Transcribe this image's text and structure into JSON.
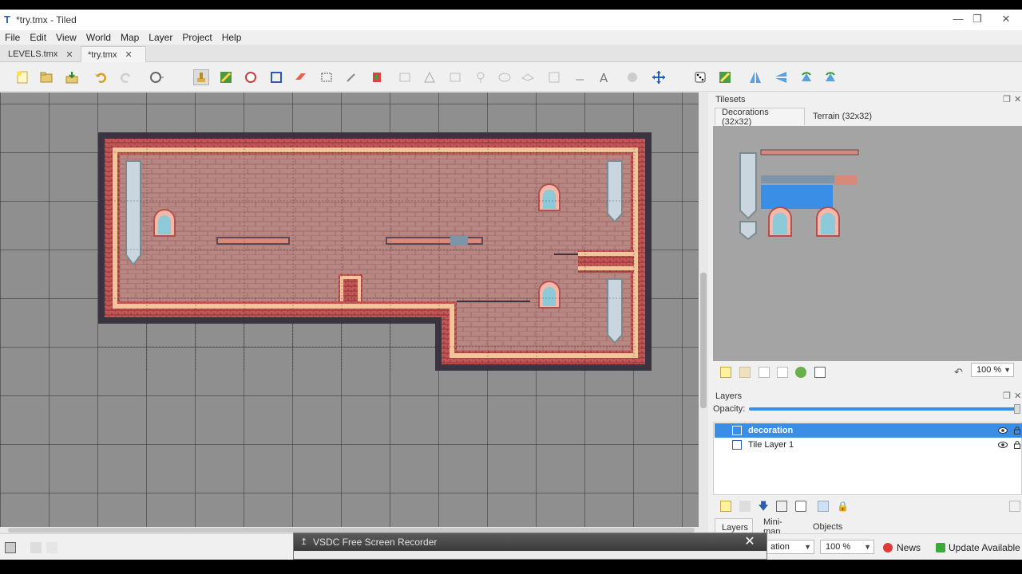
{
  "window": {
    "title": "*try.tmx - Tiled",
    "app_icon": "T"
  },
  "menu": [
    "File",
    "Edit",
    "View",
    "World",
    "Map",
    "Layer",
    "Project",
    "Help"
  ],
  "document_tabs": [
    {
      "label": "LEVELS.tmx",
      "active": false
    },
    {
      "label": "*try.tmx",
      "active": true
    }
  ],
  "tilesets": {
    "title": "Tilesets",
    "tabs": [
      {
        "label": "Decorations (32x32)",
        "active": true
      },
      {
        "label": "Terrain (32x32)",
        "active": false
      }
    ],
    "zoom": "100 %"
  },
  "layers": {
    "title": "Layers",
    "opacity_label": "Opacity:",
    "items": [
      {
        "name": "decoration",
        "selected": true,
        "type": "tile-layer"
      },
      {
        "name": "Tile Layer 1",
        "selected": false,
        "type": "tile-layer"
      }
    ],
    "bottom_tabs": [
      {
        "label": "Layers",
        "active": true
      },
      {
        "label": "Mini-map",
        "active": false
      },
      {
        "label": "Objects",
        "active": false
      }
    ]
  },
  "statusbar": {
    "layer_select_partial": "ation",
    "zoom": "100 %",
    "news_label": "News",
    "update_label": "Update Available"
  },
  "recorder": {
    "title": "VSDC Free Screen Recorder"
  },
  "colors": {
    "selection": "#3a8ee6",
    "brick": "#b57f7a",
    "wall": "#c65a5a",
    "trim": "#f2c59a",
    "outline": "#3c3340"
  }
}
